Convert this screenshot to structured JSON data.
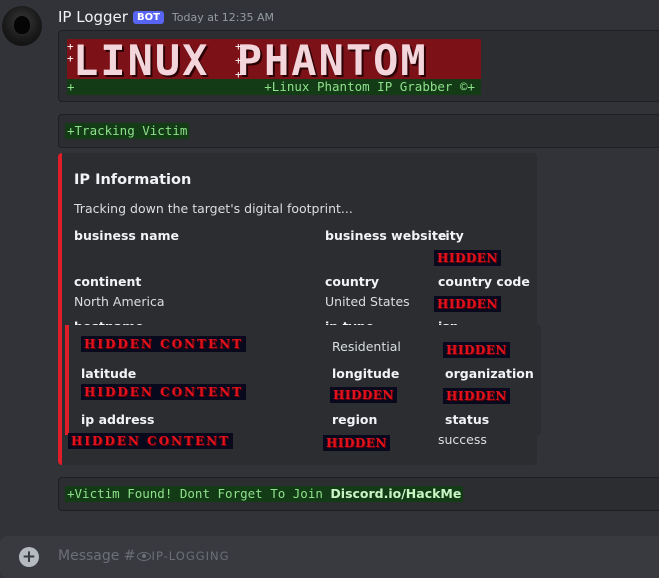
{
  "message": {
    "username": "IP Logger",
    "badge": "BOT",
    "timestamp": "Today at 12:35 AM"
  },
  "banner": {
    "art_text": "LINUX PHANTOM",
    "plus": "+",
    "footer_plus": "+",
    "footer_text": "+Linux Phantom IP Grabber ©+"
  },
  "tracking_text": "+Tracking Victim",
  "embed": {
    "accent_color": "#e01e2a",
    "title": "IP Information",
    "description": "Tracking down the target's digital footprint...",
    "hidden_label": "HIDDEN",
    "hidden_content_label": "HIDDEN CONTENT",
    "fields": {
      "business_name": {
        "name": "business name",
        "value": ""
      },
      "business_website": {
        "name": "business website",
        "value": ""
      },
      "city": {
        "name": "city",
        "value": "HIDDEN"
      },
      "continent": {
        "name": "continent",
        "value": "North America"
      },
      "country": {
        "name": "country",
        "value": "United States"
      },
      "country_code": {
        "name": "country code",
        "value": "HIDDEN"
      },
      "hostname": {
        "name": "hostname",
        "value": "HIDDEN CONTENT"
      },
      "ip_type": {
        "name": "ip type",
        "value": "Residential"
      },
      "isp": {
        "name": "isp",
        "value": "HIDDEN"
      },
      "latitude": {
        "name": "latitude",
        "value": "HIDDEN CONTENT"
      },
      "longitude": {
        "name": "longitude",
        "value": "HIDDEN"
      },
      "organization": {
        "name": "organization",
        "value": "HIDDEN"
      },
      "ip_address": {
        "name": "ip address",
        "value": "HIDDEN CONTENT"
      },
      "region": {
        "name": "region",
        "value": "HIDDEN"
      },
      "status": {
        "name": "status",
        "value": "success"
      }
    }
  },
  "found": {
    "text": "+Victim Found! Dont Forget To Join ",
    "link": "Discord.io/HackMe"
  },
  "composer": {
    "placeholder_prefix": "Message #",
    "channel": "IP-LOGGING"
  }
}
